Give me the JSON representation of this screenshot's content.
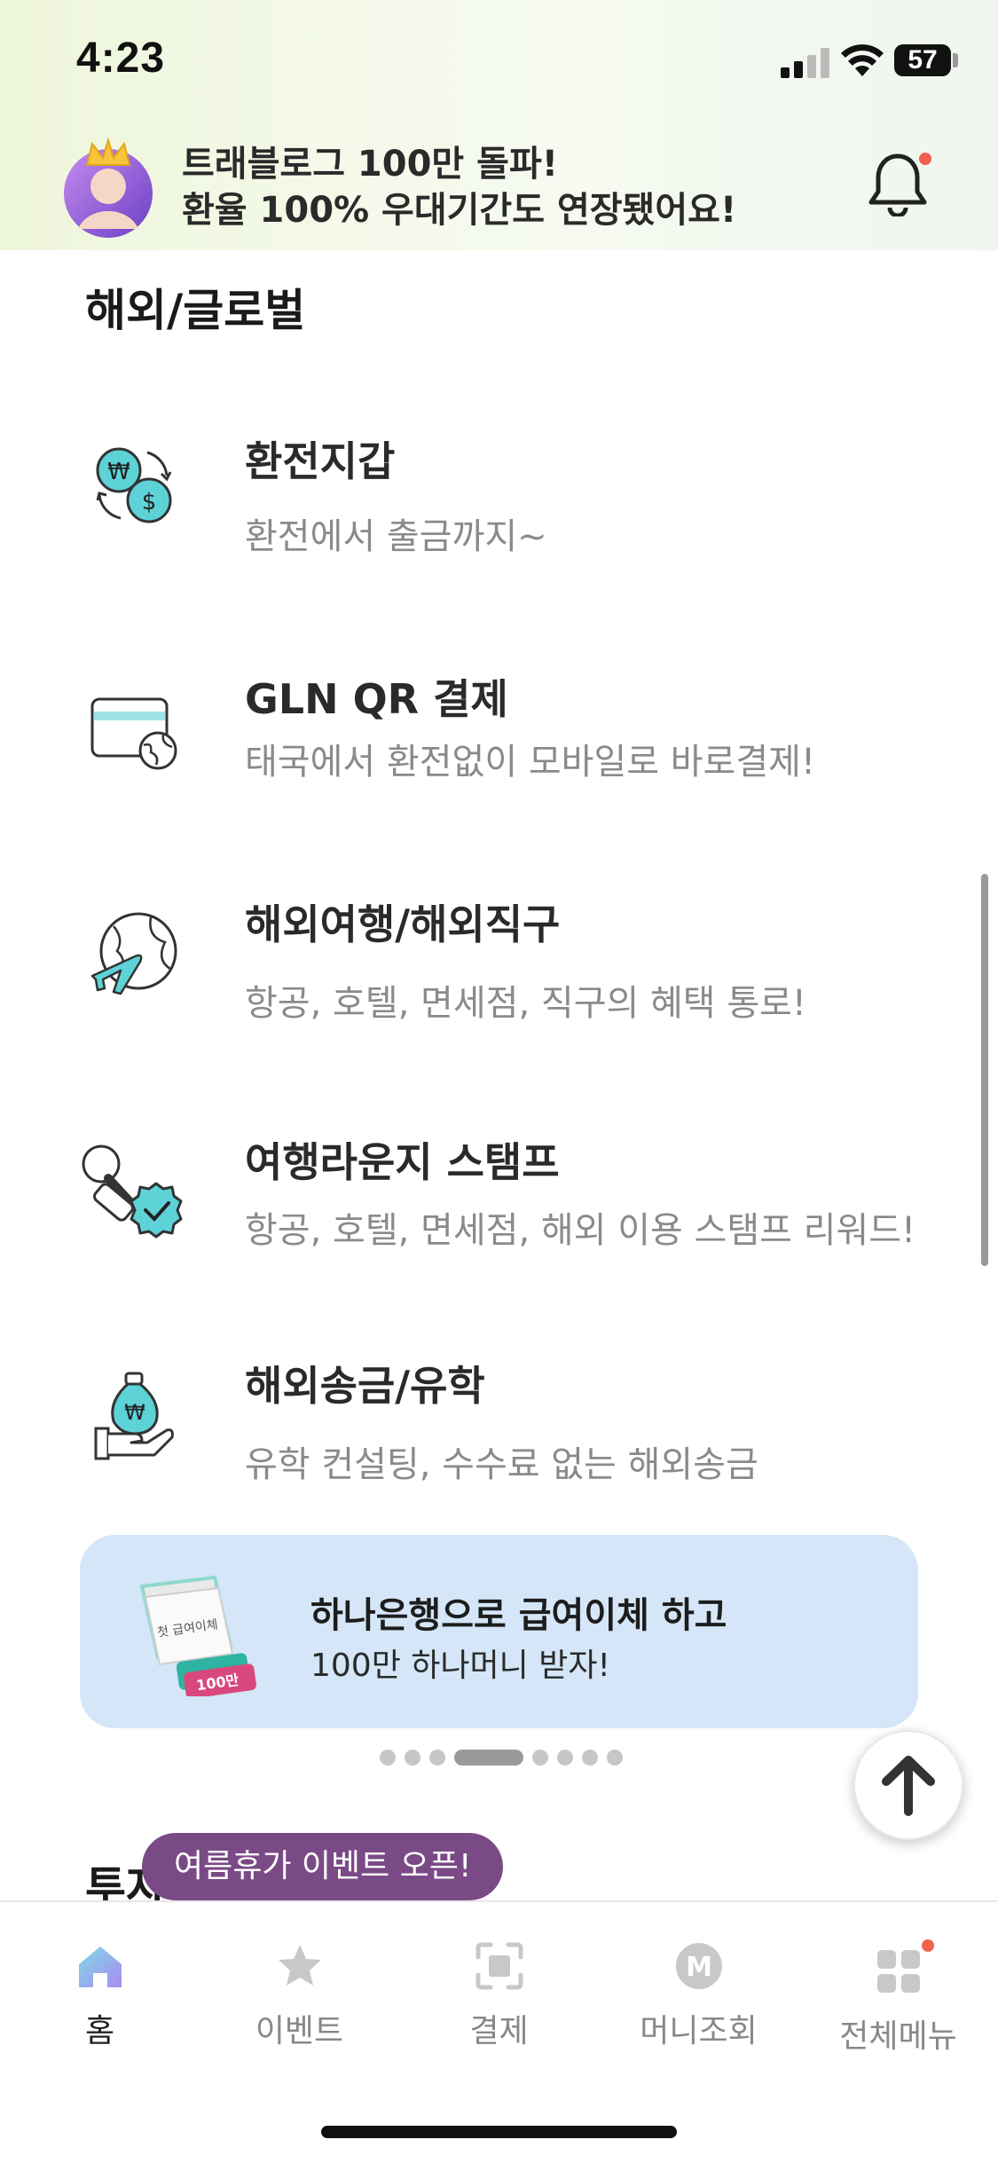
{
  "status_bar": {
    "time": "4:23",
    "battery": "57"
  },
  "promo": {
    "line1": "트래블로그 100만 돌파!",
    "line2": "환율 100% 우대기간도 연장됐어요!"
  },
  "section": {
    "title": "해외/글로벌"
  },
  "menu_items": [
    {
      "title": "환전지갑",
      "subtitle": "환전에서 출금까지~",
      "icon": "currency-exchange-icon"
    },
    {
      "title": "GLN QR 결제",
      "subtitle": "태국에서 환전없이 모바일로 바로결제!",
      "icon": "card-globe-icon"
    },
    {
      "title": "해외여행/해외직구",
      "subtitle": "항공, 호텔, 면세점, 직구의 혜택 통로!",
      "icon": "globe-airplane-icon"
    },
    {
      "title": "여행라운지 스탬프",
      "subtitle": "항공, 호텔, 면세점, 해외 이용 스탬프 리워드!",
      "icon": "stamp-icon"
    },
    {
      "title": "해외송금/유학",
      "subtitle": "유학 컨설팅, 수수료 없는 해외송금",
      "icon": "money-bag-hand-icon"
    }
  ],
  "banner": {
    "title": "하나은행으로 급여이체 하고",
    "subtitle": "100만 하나머니 받자!",
    "illus_text1": "첫 급여이체",
    "illus_text2": "100만"
  },
  "carousel": {
    "page_count": 8,
    "active_index": 3
  },
  "next_section": {
    "title": "투자"
  },
  "tooltip": {
    "text": "여름휴가 이벤트 오픈!"
  },
  "tabbar": {
    "items": [
      {
        "label": "홈",
        "icon": "home-icon",
        "active": true
      },
      {
        "label": "이벤트",
        "icon": "star-icon",
        "active": false
      },
      {
        "label": "결제",
        "icon": "scan-pay-icon",
        "active": false
      },
      {
        "label": "머니조회",
        "icon": "money-m-icon",
        "active": false
      },
      {
        "label": "전체메뉴",
        "icon": "grid-menu-icon",
        "active": false
      }
    ]
  },
  "colors": {
    "accent_teal": "#5dd3d8",
    "tooltip_purple": "#7a4a86",
    "banner_bg": "#d4e6f7",
    "notification_dot": "#f0624b"
  }
}
